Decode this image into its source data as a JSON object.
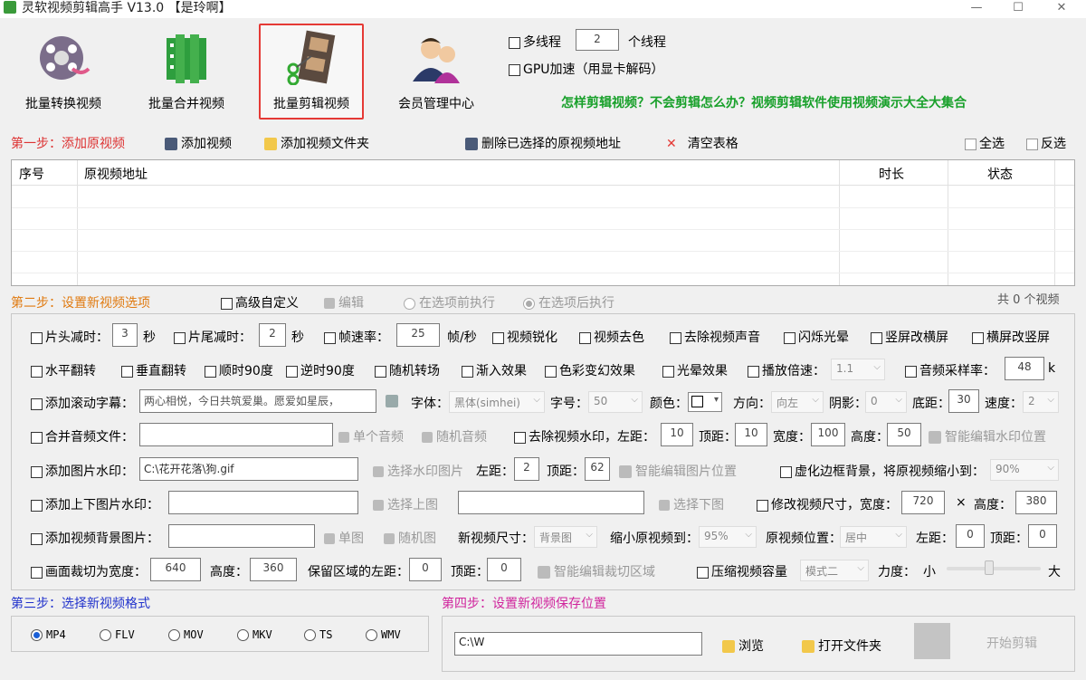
{
  "window": {
    "title": "灵软视频剪辑高手 V13.0 【是玲啊】",
    "minimize": "—",
    "maximize": "☐",
    "close": "✕"
  },
  "toolbar": {
    "batch_convert": "批量转换视频",
    "batch_merge": "批量合并视频",
    "batch_cut": "批量剪辑视频",
    "member_center": "会员管理中心",
    "multithread_label": "多线程",
    "thread_count": "2",
    "thread_unit": "个线程",
    "gpu_label": "GPU加速（用显卡解码）",
    "promo_link": "怎样剪辑视频？不会剪辑怎么办？视频剪辑软件使用视频演示大全大集合"
  },
  "step1": {
    "title": "第一步：添加原视频",
    "add_video": "添加视频",
    "add_folder": "添加视频文件夹",
    "delete_selected": "删除已选择的原视频地址",
    "clear_table": "清空表格",
    "select_all": "全选",
    "invert": "反选",
    "columns": [
      "序号",
      "原视频地址",
      "时长",
      "状态"
    ]
  },
  "step2": {
    "title": "第二步：设置新视频选项",
    "advanced": "高级自定义",
    "edit": "编辑",
    "before": "在选项前执行",
    "after": "在选项后执行",
    "total": "共 0 个视频",
    "row1": {
      "head_cut": "片头减时：",
      "head_val": "3",
      "sec1": "秒",
      "tail_cut": "片尾减时：",
      "tail_val": "2",
      "sec2": "秒",
      "fps": "帧速率：",
      "fps_val": "25",
      "fps_unit": "帧/秒",
      "sharpen": "视频锐化",
      "decolor": "视频去色",
      "mute": "去除视频声音",
      "flash": "闪烁光晕",
      "v2h": "竖屏改横屏",
      "h2v": "横屏改竖屏"
    },
    "row2": {
      "hflip": "水平翻转",
      "vflip": "垂直翻转",
      "cw90": "顺时90度",
      "ccw90": "逆时90度",
      "rand_trans": "随机转场",
      "fade_in": "渐入效果",
      "color_var": "色彩变幻效果",
      "halo": "光晕效果",
      "speed": "播放倍速：",
      "speed_val": "1.1",
      "sample_rate": "音频采样率：",
      "sample_val": "48",
      "sample_unit": "k"
    },
    "row3": {
      "scroll": "添加滚动字幕：",
      "scroll_text": "两心相悦，今日共筑爱巢。愿爱如星辰，",
      "font": "字体：",
      "font_val": "黑体(simhei)",
      "size": "字号：",
      "size_val": "50",
      "color": "颜色：",
      "dir": "方向：",
      "dir_val": "向左",
      "shadow": "阴影：",
      "shadow_val": "0",
      "bottom": "底距：",
      "bottom_val": "30",
      "spd": "速度：",
      "spd_val": "2"
    },
    "row4": {
      "merge_audio": "合并音频文件：",
      "single_audio": "单个音频",
      "rand_audio": "随机音频",
      "remove_wm": "去除视频水印，左距：",
      "left_val": "10",
      "top": "顶距：",
      "top_val": "10",
      "width": "宽度：",
      "width_val": "100",
      "height": "高度：",
      "height_val": "50",
      "smart_wm": "智能编辑水印位置"
    },
    "row5": {
      "img_wm": "添加图片水印：",
      "img_path": "C:\\花开花落\\狗.gif",
      "choose_wm": "选择水印图片",
      "left": "左距：",
      "left_val": "2",
      "top": "顶距：",
      "top_val": "62",
      "smart_img": "智能编辑图片位置",
      "blur_border": "虚化边框背景，将原视频缩小到：",
      "blur_val": "90%"
    },
    "row6": {
      "tb_wm": "添加上下图片水印：",
      "choose_top": "选择上图",
      "choose_bottom": "选择下图",
      "resize": "修改视频尺寸，宽度：",
      "w_val": "720",
      "x": "×",
      "h": "高度：",
      "h_val": "380"
    },
    "row7": {
      "bg_img": "添加视频背景图片：",
      "single_img": "单图",
      "rand_img": "随机图",
      "new_size": "新视频尺寸：",
      "new_size_val": "背景图",
      "shrink": "缩小原视频到：",
      "shrink_val": "95%",
      "orig_pos": "原视频位置：",
      "orig_pos_val": "居中",
      "left": "左距：",
      "left_val": "0",
      "top": "顶距：",
      "top_val": "0"
    },
    "row8": {
      "crop": "画面裁切为宽度：",
      "crop_w": "640",
      "height": "高度：",
      "crop_h": "360",
      "keep_left": "保留区域的左距：",
      "keep_left_val": "0",
      "top": "顶距：",
      "top_val": "0",
      "smart_crop": "智能编辑裁切区域",
      "compress": "压缩视频容量",
      "mode_val": "模式二",
      "strength": "力度：",
      "small": "小",
      "big": "大"
    }
  },
  "step3": {
    "title": "第三步：选择新视频格式",
    "formats": [
      "MP4",
      "FLV",
      "MOV",
      "MKV",
      "TS",
      "WMV"
    ],
    "selected": "MP4"
  },
  "step4": {
    "title": "第四步：设置新视频保存位置",
    "path": "C:\\W",
    "browse": "浏览",
    "open_folder": "打开文件夹",
    "start": "开始剪辑"
  },
  "colors": {
    "accent_red": "#d33",
    "step_blue": "#2233cc",
    "step_magenta": "#d0249d",
    "promo_green": "#18a02a",
    "highlight_border": "#e53935"
  }
}
